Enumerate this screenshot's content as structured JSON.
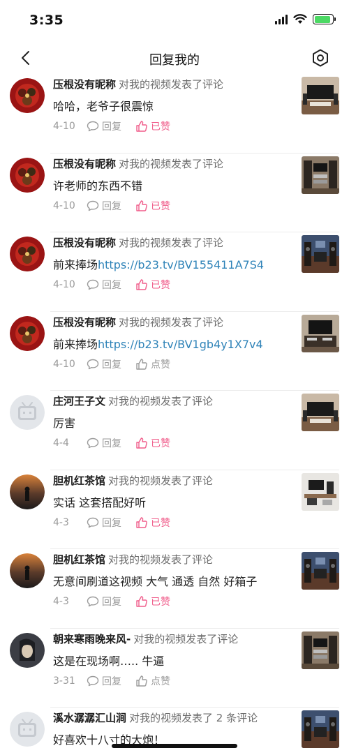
{
  "status_bar": {
    "time": "3:35",
    "battery_level": 0.9
  },
  "nav": {
    "title": "回复我的",
    "back_icon": "chevron-left-icon",
    "settings_icon": "hexagon-settings-icon"
  },
  "colors": {
    "liked": "#f05c8a",
    "link": "#2f83b8",
    "secondary": "#9a9a9a"
  },
  "items": [
    {
      "username": "压根没有昵称",
      "action": "对我的视频发表了评论",
      "text": "哈哈，老爷子很震惊",
      "link": "",
      "date": "4-10",
      "reply_label": "回复",
      "like_label": "已赞",
      "liked": true,
      "avatar": "red-dish-avatar",
      "thumb": "tv-cabinet-thumb"
    },
    {
      "username": "压根没有昵称",
      "action": "对我的视频发表了评论",
      "text": "许老师的东西不错",
      "link": "",
      "date": "4-10",
      "reply_label": "回复",
      "like_label": "已赞",
      "liked": true,
      "avatar": "red-dish-avatar",
      "thumb": "hifi-rack-thumb"
    },
    {
      "username": "压根没有昵称",
      "action": "对我的视频发表了评论",
      "text": "前来捧场",
      "link": "https://b23.tv/BV155411A7S4",
      "date": "4-10",
      "reply_label": "回复",
      "like_label": "已赞",
      "liked": true,
      "avatar": "red-dish-avatar",
      "thumb": "speaker-room-thumb"
    },
    {
      "username": "压根没有昵称",
      "action": "对我的视频发表了评论",
      "text": "前来捧场",
      "link": "https://b23.tv/BV1gb4y1X7v4",
      "date": "4-10",
      "reply_label": "回复",
      "like_label": "点赞",
      "liked": false,
      "avatar": "red-dish-avatar",
      "thumb": "tv-stand-thumb"
    },
    {
      "username": "庄河王子文",
      "action": "对我的视频发表了评论",
      "text": "厉害",
      "link": "",
      "date": "4-4",
      "reply_label": "回复",
      "like_label": "已赞",
      "liked": true,
      "avatar": "default-tv-avatar",
      "thumb": "tv-cabinet-thumb"
    },
    {
      "username": "胆机红茶馆",
      "action": "对我的视频发表了评论",
      "text": "实话 这套搭配好听",
      "link": "",
      "date": "4-3",
      "reply_label": "回复",
      "like_label": "已赞",
      "liked": true,
      "avatar": "sunset-avatar",
      "thumb": "desk-setup-thumb"
    },
    {
      "username": "胆机红茶馆",
      "action": "对我的视频发表了评论",
      "text": "无意间刷道这视频 大气 通透 自然 好箱子",
      "link": "",
      "date": "4-3",
      "reply_label": "回复",
      "like_label": "已赞",
      "liked": true,
      "avatar": "sunset-avatar",
      "thumb": "speaker-room-thumb"
    },
    {
      "username": "朝来寒雨晚来风-",
      "action": "对我的视频发表了评论",
      "text": "这是在现场啊….. 牛逼",
      "link": "",
      "date": "3-31",
      "reply_label": "回复",
      "like_label": "点赞",
      "liked": false,
      "avatar": "dark-portrait-avatar",
      "thumb": "hifi-rack-thumb"
    },
    {
      "username": "溪水潺潺汇山涧",
      "action": "对我的视频发表了 2 条评论",
      "text": "好喜欢十八寸的大炮！",
      "link": "",
      "date": "",
      "reply_label": "",
      "like_label": "",
      "liked": false,
      "avatar": "default-tv-avatar",
      "thumb": "speaker-room-thumb"
    }
  ]
}
